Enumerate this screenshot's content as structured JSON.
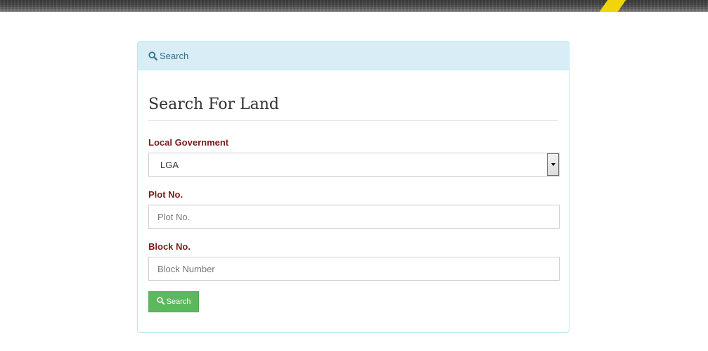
{
  "panel": {
    "heading_icon": "search-icon",
    "heading_label": "Search"
  },
  "form": {
    "title": "Search For Land",
    "lga": {
      "label": "Local Government",
      "selected_value": "LGA"
    },
    "plot": {
      "label": "Plot No.",
      "placeholder": "Plot No.",
      "value": ""
    },
    "block": {
      "label": "Block No.",
      "placeholder": "Block Number",
      "value": ""
    },
    "submit": {
      "icon": "search-icon",
      "label": "Search"
    }
  },
  "colors": {
    "heading_bg": "#d9edf7",
    "heading_text": "#31708f",
    "label_text": "#7a1a1a",
    "button_bg": "#5cb85c",
    "lane_marking": "#f2d40a"
  }
}
